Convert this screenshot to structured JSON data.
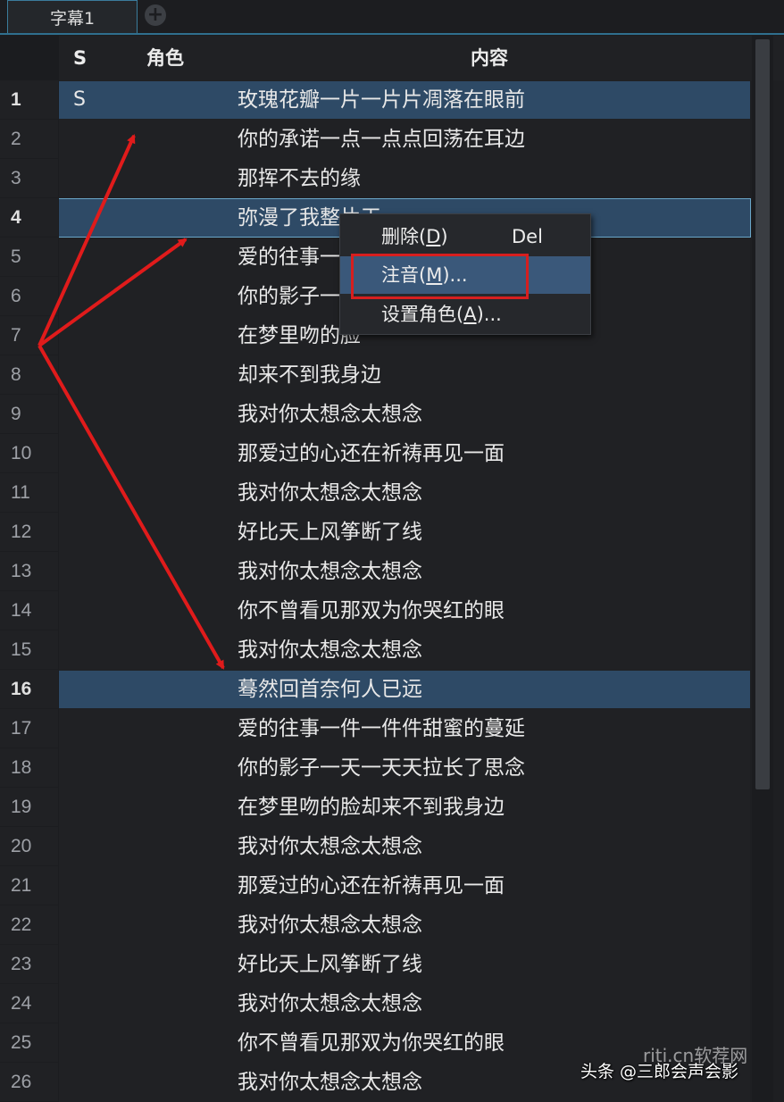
{
  "tabs": [
    {
      "label": "字幕1"
    }
  ],
  "add_tab_symbol": "+",
  "columns": {
    "style": "S",
    "role": "角色",
    "content": "内容"
  },
  "rows": [
    {
      "num": "1",
      "style": "S",
      "text": "玫瑰花瓣一片一片片凋落在眼前"
    },
    {
      "num": "2",
      "style": "",
      "text": "你的承诺一点一点点回荡在耳边"
    },
    {
      "num": "3",
      "style": "",
      "text": "那挥不去的缘"
    },
    {
      "num": "4",
      "style": "",
      "text": "弥漫了我整片天"
    },
    {
      "num": "5",
      "style": "",
      "text": "爱的往事一"
    },
    {
      "num": "6",
      "style": "",
      "text": "你的影子一"
    },
    {
      "num": "7",
      "style": "",
      "text": "在梦里吻的脸"
    },
    {
      "num": "8",
      "style": "",
      "text": "却来不到我身边"
    },
    {
      "num": "9",
      "style": "",
      "text": "我对你太想念太想念"
    },
    {
      "num": "10",
      "style": "",
      "text": "那爱过的心还在祈祷再见一面"
    },
    {
      "num": "11",
      "style": "",
      "text": "我对你太想念太想念"
    },
    {
      "num": "12",
      "style": "",
      "text": "好比天上风筝断了线"
    },
    {
      "num": "13",
      "style": "",
      "text": "我对你太想念太想念"
    },
    {
      "num": "14",
      "style": "",
      "text": "你不曾看见那双为你哭红的眼"
    },
    {
      "num": "15",
      "style": "",
      "text": "我对你太想念太想念"
    },
    {
      "num": "16",
      "style": "",
      "text": "蓦然回首奈何人已远"
    },
    {
      "num": "17",
      "style": "",
      "text": "爱的往事一件一件件甜蜜的蔓延"
    },
    {
      "num": "18",
      "style": "",
      "text": "你的影子一天一天天拉长了思念"
    },
    {
      "num": "19",
      "style": "",
      "text": "在梦里吻的脸却来不到我身边"
    },
    {
      "num": "20",
      "style": "",
      "text": "我对你太想念太想念"
    },
    {
      "num": "21",
      "style": "",
      "text": "那爱过的心还在祈祷再见一面"
    },
    {
      "num": "22",
      "style": "",
      "text": "我对你太想念太想念"
    },
    {
      "num": "23",
      "style": "",
      "text": "好比天上风筝断了线"
    },
    {
      "num": "24",
      "style": "",
      "text": "我对你太想念太想念"
    },
    {
      "num": "25",
      "style": "",
      "text": "你不曾看见那双为你哭红的眼"
    },
    {
      "num": "26",
      "style": "",
      "text": "我对你太想念太想念"
    }
  ],
  "context_menu": {
    "delete_label": "删除(",
    "delete_key": "D",
    "delete_close": ")",
    "delete_shortcut": "Del",
    "annotate_label": "注音(",
    "annotate_key": "M",
    "annotate_close": ")...",
    "set_role_label": "设置角色(",
    "set_role_key": "A",
    "set_role_close": ")..."
  },
  "watermark": {
    "text": "头条 @三郎会声会影",
    "text2": "riti.cn软荐网"
  },
  "colors": {
    "selection": "#2e4a66",
    "annotation_red": "#d61f1f",
    "accent": "#3b7c9c"
  }
}
